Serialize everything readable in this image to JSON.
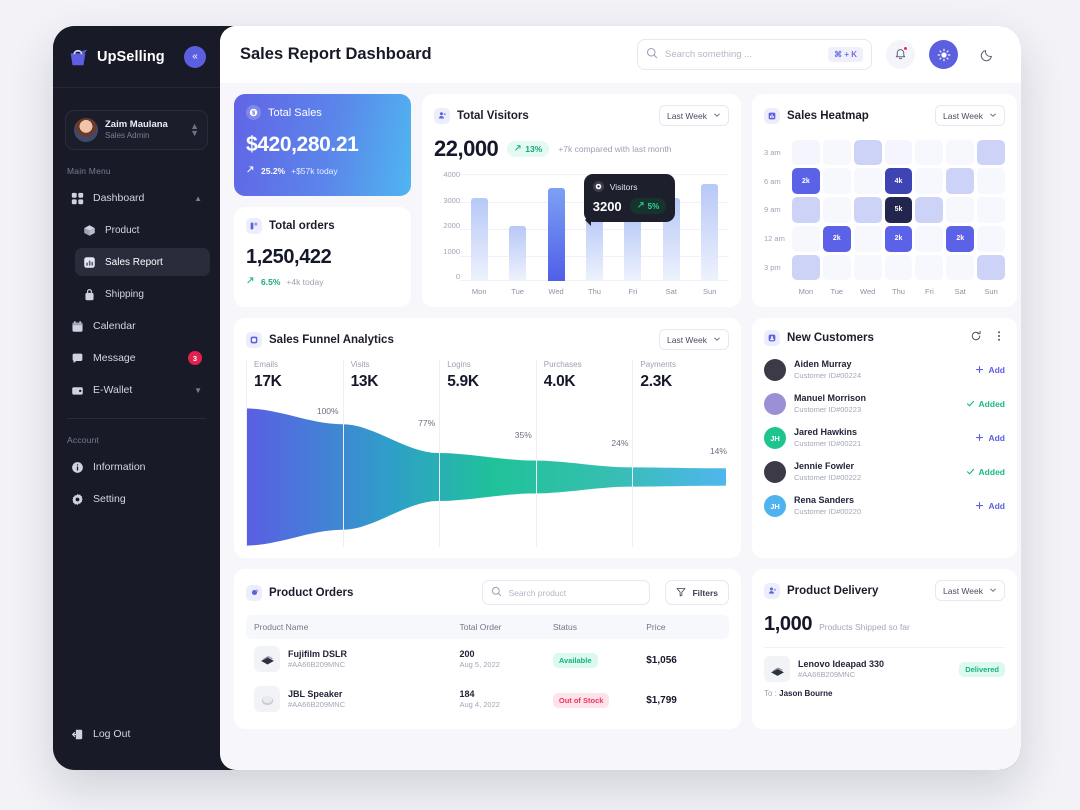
{
  "sidebar": {
    "brand": "UpSelling",
    "collapse_icon": "chevrons-left-icon",
    "profile": {
      "name": "Zaim Maulana",
      "role": "Sales Admin"
    },
    "main_menu_label": "Main Menu",
    "account_label": "Account",
    "items": [
      {
        "label": "Dashboard",
        "icon": "grid-icon",
        "expanded": true
      },
      {
        "label": "Product",
        "icon": "box-icon",
        "sub": true
      },
      {
        "label": "Sales Report",
        "icon": "chart-icon",
        "sub": true,
        "active": true
      },
      {
        "label": "Shipping",
        "icon": "bag-icon",
        "sub": true
      },
      {
        "label": "Calendar",
        "icon": "calendar-icon"
      },
      {
        "label": "Message",
        "icon": "chat-icon",
        "badge": "3"
      },
      {
        "label": "E-Wallet",
        "icon": "wallet-icon",
        "chevron": true
      }
    ],
    "account_items": [
      {
        "label": "Information",
        "icon": "info-icon"
      },
      {
        "label": "Setting",
        "icon": "gear-icon"
      }
    ],
    "logout": {
      "label": "Log Out",
      "icon": "logout-icon"
    }
  },
  "topbar": {
    "title": "Sales Report Dashboard",
    "search_placeholder": "Search something ...",
    "search_value": "",
    "shortcut": "⌘ + K",
    "notification_icon": "bell-icon",
    "light_icon": "sun-icon",
    "dark_icon": "moon-icon"
  },
  "total_sales": {
    "label": "Total Sales",
    "icon": "dollar-icon",
    "value": "$420,280.21",
    "delta": "25.2%",
    "note": "+$57k today"
  },
  "total_orders": {
    "label": "Total orders",
    "icon": "orders-icon",
    "value": "1,250,422",
    "delta": "6.5%",
    "note": "+4k today"
  },
  "visitors": {
    "title": "Total Visitors",
    "icon": "users-icon",
    "range": "Last Week",
    "value": "22,000",
    "delta": "13%",
    "note": "+7k compared with last month",
    "tooltip": {
      "label": "Visitors",
      "value": "3200",
      "delta": "5%"
    }
  },
  "heatmap": {
    "title": "Sales Heatmap",
    "icon": "heatmap-icon",
    "range": "Last Week"
  },
  "funnel": {
    "title": "Sales Funnel Analytics",
    "icon": "funnel-icon",
    "range": "Last Week"
  },
  "customers": {
    "title": "New Customers",
    "icon": "user-plus-icon",
    "refresh_icon": "refresh-icon",
    "more_icon": "more-vertical-icon",
    "rows": [
      {
        "name": "Aiden Murray",
        "id": "Customer ID#00224",
        "action": "Add",
        "state": "add",
        "avatar_color": "#3b3a46",
        "initials": ""
      },
      {
        "name": "Manuel Morrison",
        "id": "Customer ID#00223",
        "action": "Added",
        "state": "added",
        "avatar_color": "#9b8fd6",
        "initials": ""
      },
      {
        "name": "Jared Hawkins",
        "id": "Customer ID#00221",
        "action": "Add",
        "state": "add",
        "avatar_color": "#1ec48e",
        "initials": "JH"
      },
      {
        "name": "Jennie Fowler",
        "id": "Customer ID#00222",
        "action": "Added",
        "state": "added",
        "avatar_color": "#3b3a46",
        "initials": ""
      },
      {
        "name": "Rena Sanders",
        "id": "Customer ID#00220",
        "action": "Add",
        "state": "add",
        "avatar_color": "#4fb3f0",
        "initials": "JH"
      }
    ]
  },
  "product_orders": {
    "title": "Product Orders",
    "icon": "orders-dot-icon",
    "search_placeholder": "Search product",
    "search_value": "",
    "filters_label": "Filters",
    "filters_icon": "filter-icon",
    "columns": [
      "Product Name",
      "Total Order",
      "Status",
      "Price"
    ],
    "rows": [
      {
        "name": "Fujifilm DSLR",
        "sku": "#AA66B209MNC",
        "order": "200",
        "date": "Aug 5, 2022",
        "status": "Available",
        "status_type": "ok",
        "price": "$1,056",
        "thumb": "camera-icon"
      },
      {
        "name": "JBL Speaker",
        "sku": "#AA66B209MNC",
        "order": "184",
        "date": "Aug 4, 2022",
        "status": "Out of Stock",
        "status_type": "no",
        "price": "$1,799",
        "thumb": "speaker-icon"
      }
    ]
  },
  "delivery": {
    "title": "Product Delivery",
    "icon": "delivery-icon",
    "range": "Last Week",
    "count": "1,000",
    "note": "Products Shipped so far",
    "items": [
      {
        "name": "Lenovo Ideapad 330",
        "sku": "#AA66B209MNC",
        "status": "Delivered",
        "to_label": "To :",
        "to": "Jason Bourne",
        "thumb": "laptop-icon"
      }
    ]
  },
  "chart_data": [
    {
      "type": "bar",
      "title": "Total Visitors",
      "categories": [
        "Mon",
        "Tue",
        "Wed",
        "Thu",
        "Fri",
        "Sat",
        "Sun"
      ],
      "values": [
        3000,
        2000,
        3350,
        2400,
        2400,
        3000,
        3500
      ],
      "highlight_index": 2,
      "ylabel": "",
      "xlabel": "",
      "ylim": [
        0,
        4000
      ],
      "yticks": [
        4000,
        3000,
        2000,
        1000,
        0
      ],
      "grid": true,
      "legend": "none"
    },
    {
      "type": "heatmap",
      "title": "Sales Heatmap",
      "x": [
        "Mon",
        "Tue",
        "Wed",
        "Thu",
        "Fri",
        "Sat",
        "Sun"
      ],
      "y": [
        "3 am",
        "6 am",
        "9 am",
        "12 am",
        "3 pm"
      ],
      "cells": [
        [
          {
            "v": 0,
            "c": "#f4f5fd",
            "t": ""
          },
          {
            "v": 0,
            "c": "#f7f8fd",
            "t": ""
          },
          {
            "v": 0,
            "c": "#cdd3f7",
            "t": ""
          },
          {
            "v": 0,
            "c": "#f4f5fd",
            "t": ""
          },
          {
            "v": 0,
            "c": "#f7f8fd",
            "t": ""
          },
          {
            "v": 0,
            "c": "#f7f8fd",
            "t": ""
          },
          {
            "v": 0,
            "c": "#cdd3f7",
            "t": ""
          }
        ],
        [
          {
            "v": 2000,
            "c": "#5b62e8",
            "t": "2k"
          },
          {
            "v": 0,
            "c": "#f7f8fd",
            "t": ""
          },
          {
            "v": 0,
            "c": "#f7f8fd",
            "t": ""
          },
          {
            "v": 4000,
            "c": "#3f44b5",
            "t": "4k"
          },
          {
            "v": 0,
            "c": "#f7f8fd",
            "t": ""
          },
          {
            "v": 0,
            "c": "#cdd3f7",
            "t": ""
          },
          {
            "v": 0,
            "c": "#f7f8fd",
            "t": ""
          }
        ],
        [
          {
            "v": 0,
            "c": "#cdd3f7",
            "t": ""
          },
          {
            "v": 0,
            "c": "#f7f8fd",
            "t": ""
          },
          {
            "v": 0,
            "c": "#cdd3f7",
            "t": ""
          },
          {
            "v": 5000,
            "c": "#22264f",
            "t": "5k"
          },
          {
            "v": 0,
            "c": "#cdd3f7",
            "t": ""
          },
          {
            "v": 0,
            "c": "#f7f8fd",
            "t": ""
          },
          {
            "v": 0,
            "c": "#f7f8fd",
            "t": ""
          }
        ],
        [
          {
            "v": 0,
            "c": "#f7f8fd",
            "t": ""
          },
          {
            "v": 2000,
            "c": "#5b62e8",
            "t": "2k"
          },
          {
            "v": 0,
            "c": "#f7f8fd",
            "t": ""
          },
          {
            "v": 2000,
            "c": "#5b62e8",
            "t": "2k"
          },
          {
            "v": 0,
            "c": "#f7f8fd",
            "t": ""
          },
          {
            "v": 2000,
            "c": "#5b62e8",
            "t": "2k"
          },
          {
            "v": 0,
            "c": "#f7f8fd",
            "t": ""
          }
        ],
        [
          {
            "v": 0,
            "c": "#cdd3f7",
            "t": ""
          },
          {
            "v": 0,
            "c": "#f7f8fd",
            "t": ""
          },
          {
            "v": 0,
            "c": "#f7f8fd",
            "t": ""
          },
          {
            "v": 0,
            "c": "#f7f8fd",
            "t": ""
          },
          {
            "v": 0,
            "c": "#f7f8fd",
            "t": ""
          },
          {
            "v": 0,
            "c": "#f7f8fd",
            "t": ""
          },
          {
            "v": 0,
            "c": "#cdd3f7",
            "t": ""
          }
        ]
      ]
    },
    {
      "type": "funnel",
      "title": "Sales Funnel Analytics",
      "stages": [
        {
          "name": "Emails",
          "value": "17K",
          "pct": "100%"
        },
        {
          "name": "Visits",
          "value": "13K",
          "pct": "77%"
        },
        {
          "name": "Logins",
          "value": "5.9K",
          "pct": "35%"
        },
        {
          "name": "Purchases",
          "value": "4.0K",
          "pct": "24%"
        },
        {
          "name": "Payments",
          "value": "2.3K",
          "pct": "14%"
        }
      ],
      "widths": [
        100,
        77,
        35,
        24,
        14
      ]
    }
  ],
  "colors": {
    "accent": "#5b5fe0",
    "sidebar_bg": "#191a27",
    "success": "#19b97f",
    "danger": "#f0345e",
    "page_bg": "#f7f7fb"
  }
}
